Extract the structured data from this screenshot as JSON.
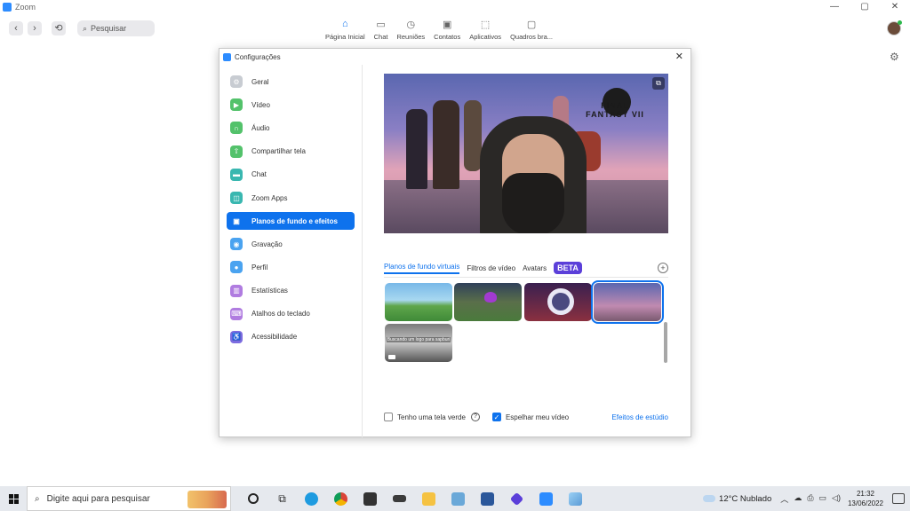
{
  "window": {
    "app_title": "Zoom",
    "controls": [
      "—",
      "▢",
      "✕"
    ]
  },
  "toolbar": {
    "search_placeholder": "Pesquisar",
    "tabs": [
      {
        "label": "Página Inicial",
        "icon": "home-icon"
      },
      {
        "label": "Chat",
        "icon": "chat-icon"
      },
      {
        "label": "Reuniões",
        "icon": "clock-icon"
      },
      {
        "label": "Contatos",
        "icon": "contacts-icon"
      },
      {
        "label": "Aplicativos",
        "icon": "apps-icon"
      },
      {
        "label": "Quadros bra...",
        "icon": "whiteboard-icon"
      }
    ]
  },
  "dialog": {
    "title": "Configurações",
    "sidebar": [
      {
        "label": "Geral",
        "icon": "gear-icon",
        "color": "#c8ccd2"
      },
      {
        "label": "Vídeo",
        "icon": "video-icon",
        "color": "#53c26b"
      },
      {
        "label": "Áudio",
        "icon": "headphones-icon",
        "color": "#53c26b"
      },
      {
        "label": "Compartilhar tela",
        "icon": "share-screen-icon",
        "color": "#53c26b"
      },
      {
        "label": "Chat",
        "icon": "chat-icon",
        "color": "#39b7b0"
      },
      {
        "label": "Zoom Apps",
        "icon": "apps-icon",
        "color": "#39b7b0"
      },
      {
        "label": "Planos de fundo e efeitos",
        "icon": "background-icon",
        "color": "#ffffff"
      },
      {
        "label": "Gravação",
        "icon": "record-icon",
        "color": "#4aa3f0"
      },
      {
        "label": "Perfil",
        "icon": "profile-icon",
        "color": "#4aa3f0"
      },
      {
        "label": "Estatísticas",
        "icon": "stats-icon",
        "color": "#b07ce0"
      },
      {
        "label": "Atalhos do teclado",
        "icon": "keyboard-icon",
        "color": "#b07ce0"
      },
      {
        "label": "Acessibilidade",
        "icon": "accessibility-icon",
        "color": "#7c6ce0"
      }
    ],
    "bg_tabs": [
      "Planos de fundo virtuais",
      "Filtros de vídeo",
      "Avatars"
    ],
    "beta_label": "BETA",
    "preview_logo_text": "FINAL FANTASY VII",
    "thumb_caption": "Buscando um logo para sapburi",
    "options": {
      "green_screen": "Tenho uma tela verde",
      "mirror": "Espelhar meu vídeo",
      "studio": "Efeitos de estúdio",
      "mirror_checked": true
    }
  },
  "taskbar": {
    "search_placeholder": "Digite aqui para pesquisar",
    "weather": "12°C  Nublado",
    "lang": "POR PTB2",
    "time": "21:32",
    "date": "13/06/2022"
  }
}
